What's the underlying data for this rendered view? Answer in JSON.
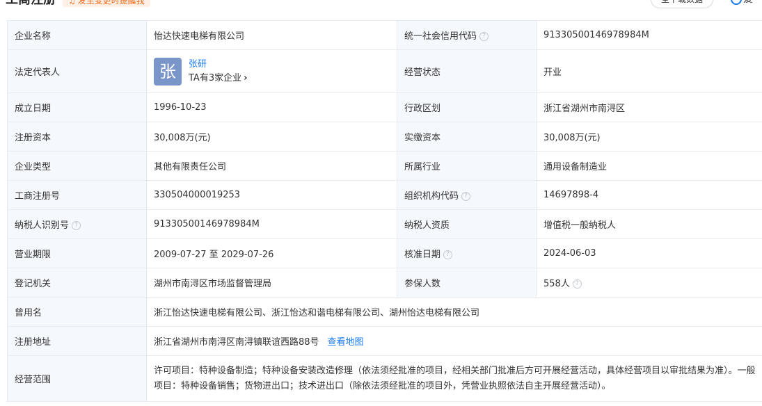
{
  "header": {
    "title": "工商注册",
    "remind_label": "发生变更时提醒我",
    "download_label": "全下载数据",
    "more_label": "爱"
  },
  "rows": [
    {
      "l1": "企业名称",
      "v1": "怡达快速电梯有限公司",
      "l2": "统一社会信用代码",
      "v2": "91330500146978984M"
    },
    {
      "l1": "法定代表人",
      "l2": "经营状态",
      "v2": "开业"
    },
    {
      "l1": "成立日期",
      "v1": "1996-10-23",
      "l2": "行政区划",
      "v2": "浙江省湖州市南浔区"
    },
    {
      "l1": "注册资本",
      "v1": "30,008万(元)",
      "l2": "实缴资本",
      "v2": "30,008万(元)"
    },
    {
      "l1": "企业类型",
      "v1": "其他有限责任公司",
      "l2": "所属行业",
      "v2": "通用设备制造业"
    },
    {
      "l1": "工商注册号",
      "v1": "330504000019253",
      "l2": "组织机构代码",
      "v2": "14697898-4"
    },
    {
      "l1": "纳税人识别号",
      "v1": "91330500146978984M",
      "l2": "纳税人资质",
      "v2": "增值税一般纳税人"
    },
    {
      "l1": "营业期限",
      "v1": "2009-07-27 至 2029-07-26",
      "l2": "核准日期",
      "v2": "2024-06-03"
    },
    {
      "l1": "登记机关",
      "v1": "湖州市南浔区市场监督管理局",
      "l2": "参保人数",
      "v2": "558人"
    },
    {
      "l1": "曾用名",
      "v1": "浙江怡达快速电梯有限公司、浙江怡达和谐电梯有限公司、湖州怡达电梯有限公司"
    },
    {
      "l1": "注册地址",
      "v1": "浙江省湖州市南浔区南浔镇联谊西路88号",
      "link": "查看地图"
    },
    {
      "l1": "经营范围",
      "v1": "许可项目：特种设备制造；特种设备安装改造修理（依法须经批准的项目，经相关部门批准后方可开展经营活动，具体经营项目以审批结果为准）。一般项目：特种设备销售；货物进出口；技术进出口（除依法须经批准的项目外，凭营业执照依法自主开展经营活动）。"
    }
  ],
  "legal_rep": {
    "avatar_char": "张",
    "name": "张研",
    "companies": "TA有3家企业"
  },
  "help_glyph": "?",
  "colors": {
    "link": "#1a7bf0",
    "label_bg": "#f5f8fc",
    "avatar_bg": "#7a95c9",
    "remind": "#f06a1c"
  }
}
